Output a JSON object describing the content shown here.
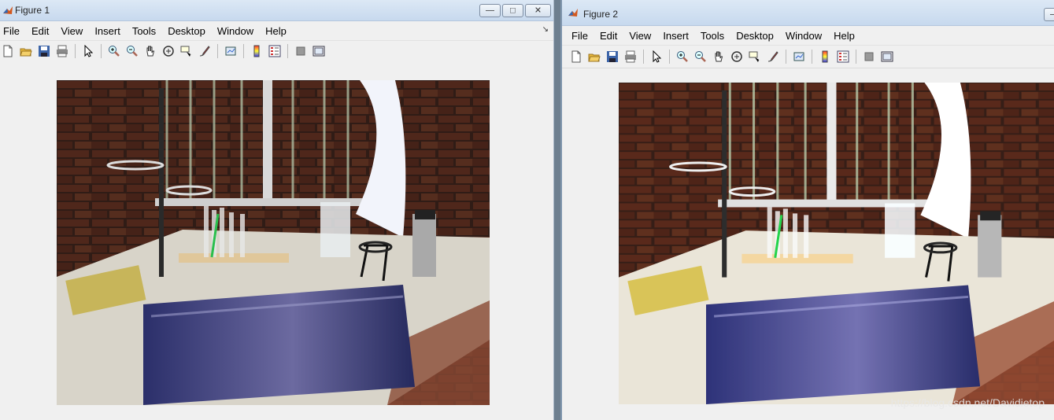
{
  "figure1": {
    "title": "Figure 1",
    "menu": [
      "File",
      "Edit",
      "View",
      "Insert",
      "Tools",
      "Desktop",
      "Window",
      "Help"
    ],
    "dock_glyph": "↘"
  },
  "figure2": {
    "title": "Figure 2",
    "menu": [
      "File",
      "Edit",
      "View",
      "Insert",
      "Tools",
      "Desktop",
      "Window",
      "Help"
    ]
  },
  "toolbar_icons": [
    "new-figure-icon",
    "open-icon",
    "save-icon",
    "print-icon",
    "pointer-icon",
    "zoom-in-icon",
    "zoom-out-icon",
    "pan-hand-icon",
    "rotate-3d-icon",
    "data-cursor-icon",
    "brush-icon",
    "link-plot-icon",
    "colorbar-icon",
    "legend-icon",
    "hide-plot-tools-icon",
    "show-plot-tools-icon"
  ],
  "window_buttons": {
    "minimize": "—",
    "maximize": "□",
    "close": "✕"
  },
  "watermark": "https://blog.csdn.net/Davidietop",
  "colors": {
    "titlebar": "#c7d9ee",
    "window_bg": "#f0f0f0",
    "matlab_logo": "#d2581f"
  }
}
